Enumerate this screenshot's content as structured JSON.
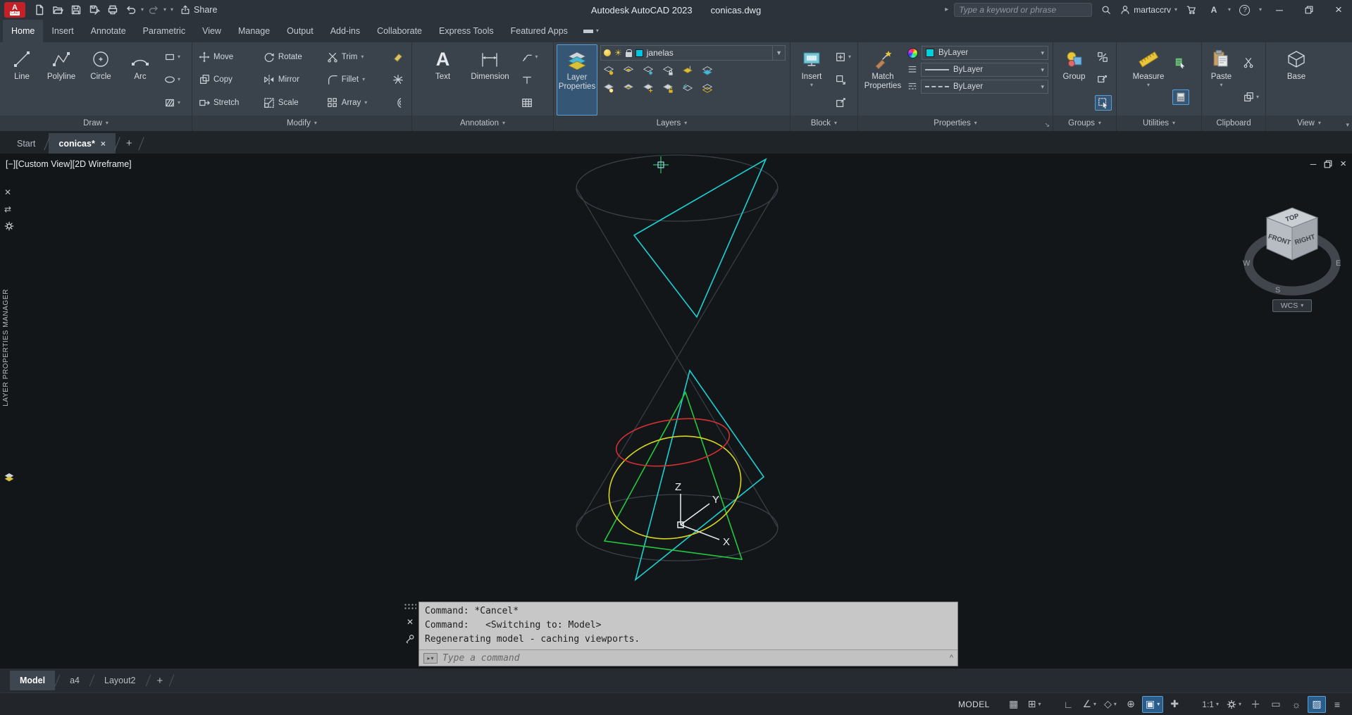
{
  "colors": {
    "accent_blue": "#4a90d9",
    "layer_color_swatch": "#00c8e0",
    "property_color_swatch": "#00d2e0",
    "conic_cyan": "#1ad1d1",
    "conic_green": "#22c93e",
    "conic_yellow": "#d8d41e",
    "conic_red": "#d43030"
  },
  "titlebar": {
    "share_label": "Share",
    "app_title": "Autodesk AutoCAD 2023",
    "document_name": "conicas.dwg",
    "search_placeholder": "Type a keyword or phrase",
    "username": "martaccrv",
    "help_label": "?"
  },
  "ribbon_tabs": [
    "Home",
    "Insert",
    "Annotate",
    "Parametric",
    "View",
    "Manage",
    "Output",
    "Add-ins",
    "Collaborate",
    "Express Tools",
    "Featured Apps"
  ],
  "ribbon": {
    "draw": {
      "label": "Draw",
      "line": "Line",
      "polyline": "Polyline",
      "circle": "Circle",
      "arc": "Arc"
    },
    "modify": {
      "label": "Modify",
      "move": "Move",
      "rotate": "Rotate",
      "trim": "Trim",
      "copy": "Copy",
      "mirror": "Mirror",
      "fillet": "Fillet",
      "stretch": "Stretch",
      "scale": "Scale",
      "array": "Array"
    },
    "annotation": {
      "label": "Annotation",
      "text": "Text",
      "dimension": "Dimension"
    },
    "layers": {
      "label": "Layers",
      "layer_properties": "Layer Properties",
      "current_layer": "janelas"
    },
    "block": {
      "label": "Block",
      "insert": "Insert"
    },
    "properties": {
      "label": "Properties",
      "match_properties": "Match Properties",
      "color_value": "ByLayer",
      "lineweight_value": "ByLayer",
      "linetype_value": "ByLayer"
    },
    "groups": {
      "label": "Groups",
      "group": "Group"
    },
    "utilities": {
      "label": "Utilities",
      "measure": "Measure"
    },
    "clipboard": {
      "label": "Clipboard",
      "paste": "Paste"
    },
    "view": {
      "label": "View",
      "base": "Base"
    }
  },
  "file_tabs": {
    "start": "Start",
    "drawing": "conicas*"
  },
  "viewport": {
    "controls_label": "[−][Custom View][2D Wireframe]",
    "palette_title": "LAYER PROPERTIES MANAGER",
    "ucs": {
      "x": "X",
      "y": "Y",
      "z": "Z"
    },
    "viewcube": {
      "top": "TOP",
      "front": "FRONT",
      "right": "RIGHT",
      "west": "W",
      "south": "S",
      "east": "E",
      "wcs_label": "WCS"
    }
  },
  "command_window": {
    "lines": [
      "Command: *Cancel*",
      "Command:   <Switching to: Model>",
      "Regenerating model - caching viewports."
    ],
    "input_placeholder": "Type a command"
  },
  "layout_tabs": {
    "model": "Model",
    "a4": "a4",
    "layout2": "Layout2"
  },
  "status_bar": {
    "model_label": "MODEL",
    "annotation_scale": "1:1"
  }
}
